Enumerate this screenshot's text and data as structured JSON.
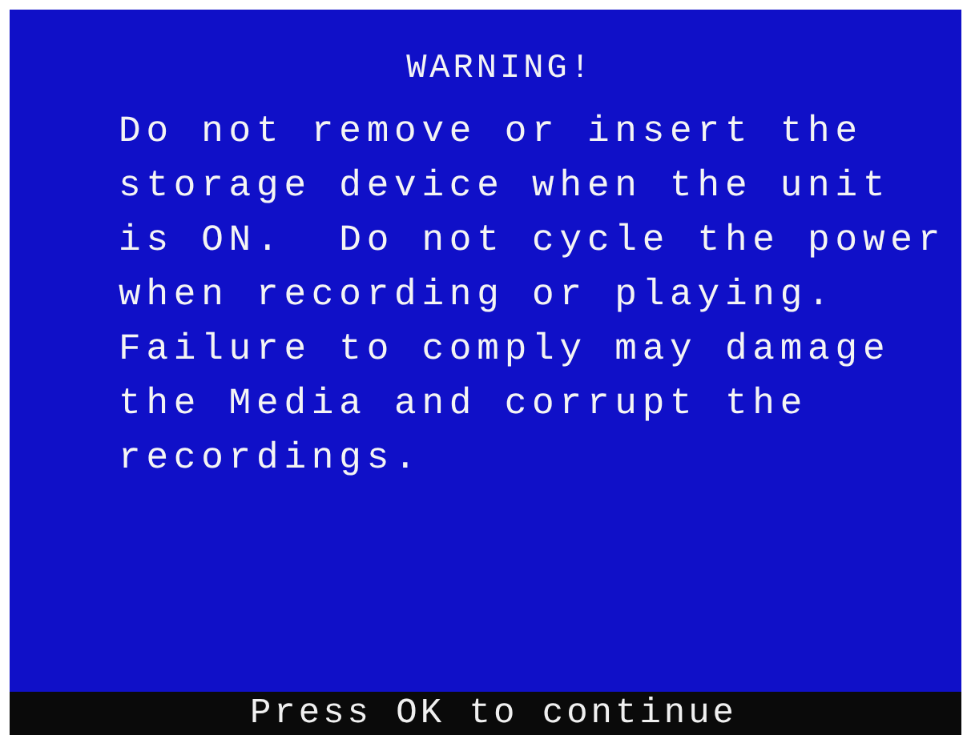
{
  "title": "WARNING!",
  "message": "Do not remove or insert the\nstorage device when the unit\nis ON.  Do not cycle the power\nwhen recording or playing.\nFailure to comply may damage\nthe Media and corrupt the\nrecordings.",
  "footer": "Press OK to continue"
}
